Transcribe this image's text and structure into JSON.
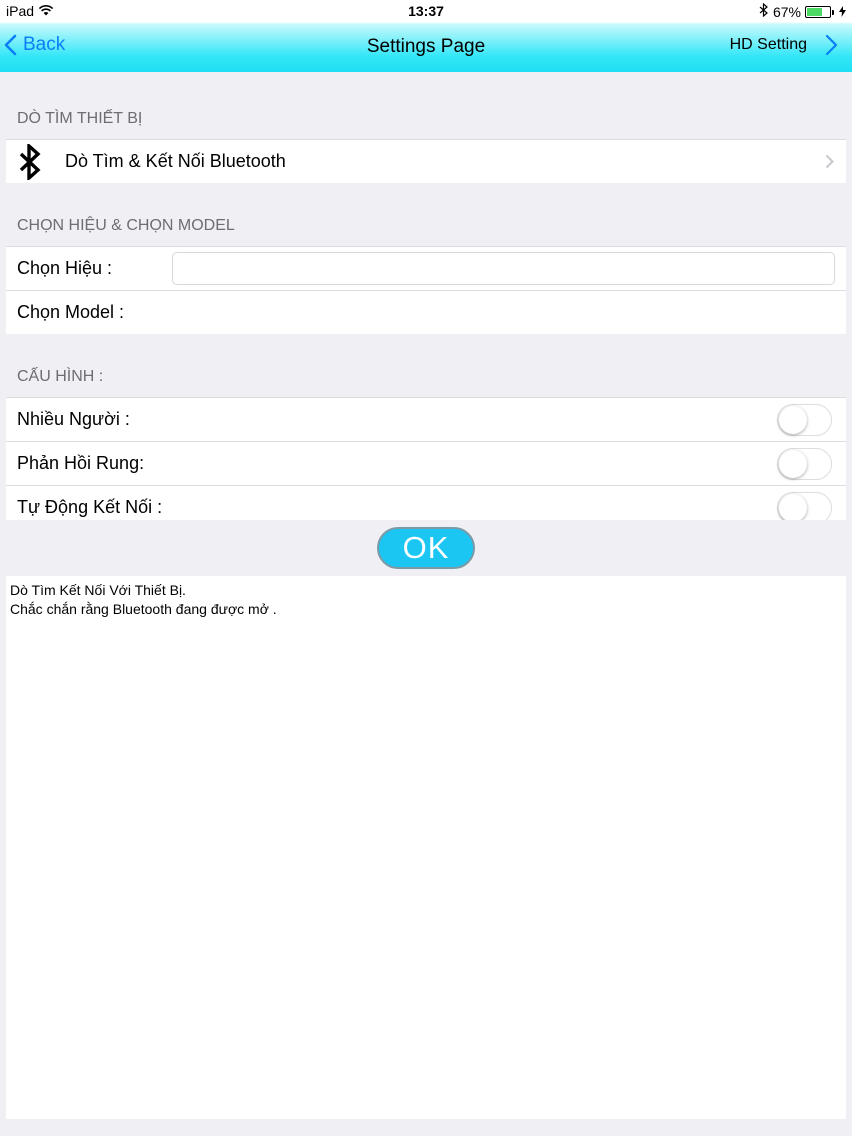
{
  "status_bar": {
    "carrier": "iPad",
    "time": "13:37",
    "battery": "67%",
    "battery_level": 0.67
  },
  "nav": {
    "back_label": "Back",
    "title": "Settings Page",
    "right_label": "HD Setting"
  },
  "sections": {
    "scan_header": "DÒ TÌM THIẾT BỊ",
    "scan_row": "Dò Tìm & Kết Nối Bluetooth",
    "brand_header": "CHỌN HIỆU & CHỌN MODEL",
    "brand_label": "Chọn Hiệu :",
    "brand_value": "",
    "model_label": "Chọn Model :",
    "config_header": "CẤU HÌNH :",
    "multi_user_label": "Nhiều Người :",
    "multi_user_on": false,
    "vibration_label": "Phản Hồi Rung:",
    "vibration_on": false,
    "auto_connect_label": "Tự Động Kết Nối :",
    "auto_connect_on": false
  },
  "ok_label": "OK",
  "log": {
    "line1": "Dò Tìm Kết Nối Với Thiết Bị.",
    "line2": "Chắc chắn rằng Bluetooth đang được mở ."
  },
  "colors": {
    "accent": "#0a7ff5",
    "nav_gradient": "#1fdff3",
    "ok_button": "#1cc6f3"
  }
}
